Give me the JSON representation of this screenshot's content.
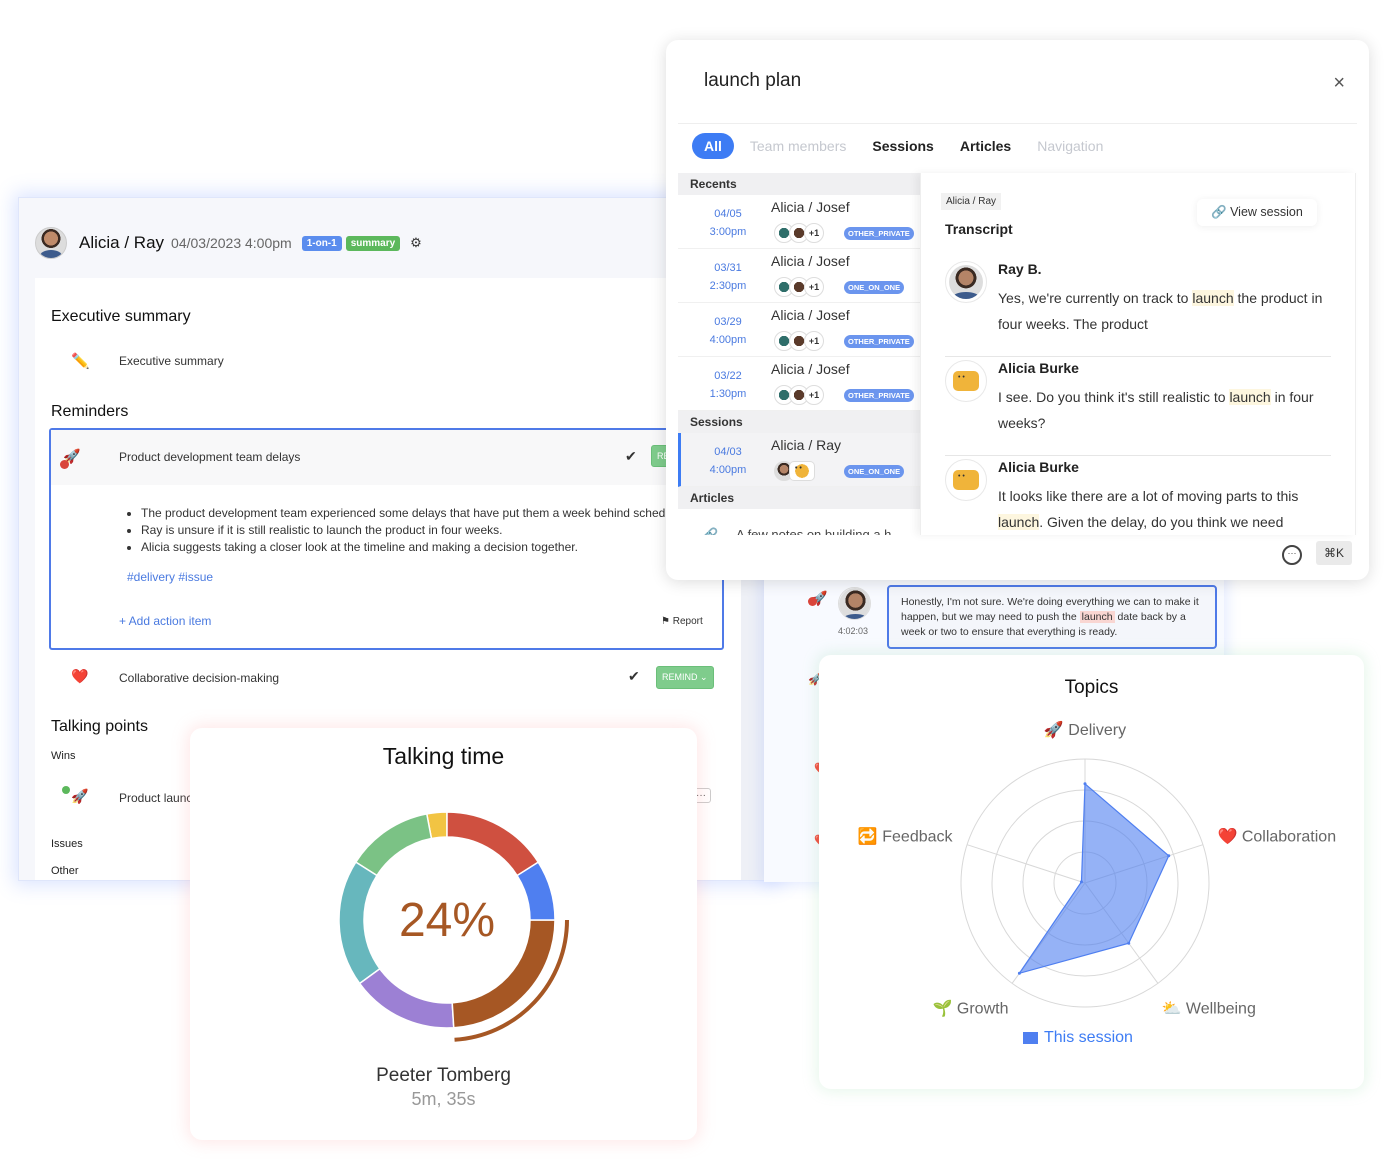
{
  "session": {
    "title": "Alicia / Ray",
    "datetime": "04/03/2023 4:00pm",
    "tags": [
      "1-on-1",
      "summary"
    ],
    "settings_icon": "gear-icon"
  },
  "sections": {
    "executive_summary": {
      "title": "Executive summary",
      "item": {
        "icon": "✏️",
        "label": "Executive summary"
      }
    },
    "reminders": {
      "title": "Reminders",
      "items": [
        {
          "icon": "🚀",
          "label": "Product development team delays",
          "button": "REMIND",
          "bullets": [
            "The product development team experienced some delays that have put them a week behind schedule.",
            "Ray is unsure if it is still realistic to launch the product in four weeks.",
            "Alicia suggests taking a closer look at the timeline and making a decision together."
          ],
          "hashtags": "#delivery #issue",
          "add_action": "+ Add action item",
          "report": "Report"
        },
        {
          "icon": "❤️",
          "label": "Collaborative decision-making",
          "button": "REMIND ⌄"
        }
      ]
    },
    "talking_points": {
      "title": "Talking points",
      "wins_label": "Wins",
      "wins_item": {
        "icon": "🚀",
        "label": "Product launch"
      },
      "issues_label": "Issues",
      "other_label": "Other"
    }
  },
  "transcript_panel": {
    "quote_before": "Honestly, I'm not sure. We're doing everything we can to make it happen, but we may need to push the ",
    "quote_highlight": "launch",
    "quote_after": " date back by a week or two to ensure that everything is ready.",
    "timestamp": "4:02:03"
  },
  "search_modal": {
    "query": "launch plan",
    "close_icon": "×",
    "filters": [
      {
        "label": "All",
        "state": "active"
      },
      {
        "label": "Team members",
        "state": "disabled"
      },
      {
        "label": "Sessions",
        "state": "enabled"
      },
      {
        "label": "Articles",
        "state": "enabled"
      },
      {
        "label": "Navigation",
        "state": "disabled"
      }
    ],
    "recents_label": "Recents",
    "recents": [
      {
        "date": "04/05",
        "time": "3:00pm",
        "name": "Alicia / Josef",
        "more": "+1",
        "tag": "OTHER_PRIVATE"
      },
      {
        "date": "03/31",
        "time": "2:30pm",
        "name": "Alicia / Josef",
        "more": "+1",
        "tag": "ONE_ON_ONE"
      },
      {
        "date": "03/29",
        "time": "4:00pm",
        "name": "Alicia / Josef",
        "more": "+1",
        "tag": "OTHER_PRIVATE"
      },
      {
        "date": "03/22",
        "time": "1:30pm",
        "name": "Alicia / Josef",
        "more": "+1",
        "tag": "OTHER_PRIVATE"
      }
    ],
    "sessions_label": "Sessions",
    "sessions": [
      {
        "date": "04/03",
        "time": "4:00pm",
        "name": "Alicia / Ray",
        "tag": "ONE_ON_ONE"
      }
    ],
    "articles_label": "Articles",
    "articles": [
      {
        "title": "A few notes on building a h"
      }
    ],
    "preview": {
      "chip": "Alicia / Ray",
      "title": "Transcript",
      "view_session": "View session",
      "messages": [
        {
          "speaker": "Ray B.",
          "before": "Yes, we're currently on track to ",
          "highlight": "launch",
          "after": " the product in four weeks. The product"
        },
        {
          "speaker": "Alicia Burke",
          "before": "I see. Do you think it's still realistic to ",
          "highlight": "launch",
          "after": " in four weeks?"
        },
        {
          "speaker": "Alicia Burke",
          "before": "It looks like there are a lot of moving parts to this ",
          "highlight": "launch",
          "after": ". Given the delay, do you think we need"
        }
      ]
    },
    "shortcut": "⌘K"
  },
  "chart_data": [
    {
      "type": "pie",
      "title": "Talking time",
      "center_label": "24%",
      "highlighted_person": "Peeter Tomberg",
      "highlighted_duration": "5m, 35s",
      "highlighted_index": 2,
      "slices": [
        {
          "value": 16,
          "color": "#cf5040"
        },
        {
          "value": 9,
          "color": "#4f7ff0"
        },
        {
          "value": 24,
          "color": "#a65724"
        },
        {
          "value": 16,
          "color": "#9c80d4"
        },
        {
          "value": 19,
          "color": "#67b7bd"
        },
        {
          "value": 13,
          "color": "#7bc285"
        },
        {
          "value": 3,
          "color": "#f2c443"
        }
      ]
    },
    {
      "type": "radar",
      "title": "Topics",
      "axes": [
        "🚀 Delivery",
        "❤️ Collaboration",
        "⛅ Wellbeing",
        "🌱 Growth",
        "🔁 Feedback"
      ],
      "range": [
        0,
        1
      ],
      "rings": 4,
      "series": [
        {
          "name": "This session",
          "color": "#4f7ff0",
          "values": [
            0.8,
            0.71,
            0.6,
            0.9,
            0.03
          ]
        }
      ],
      "legend": "bottom"
    }
  ]
}
